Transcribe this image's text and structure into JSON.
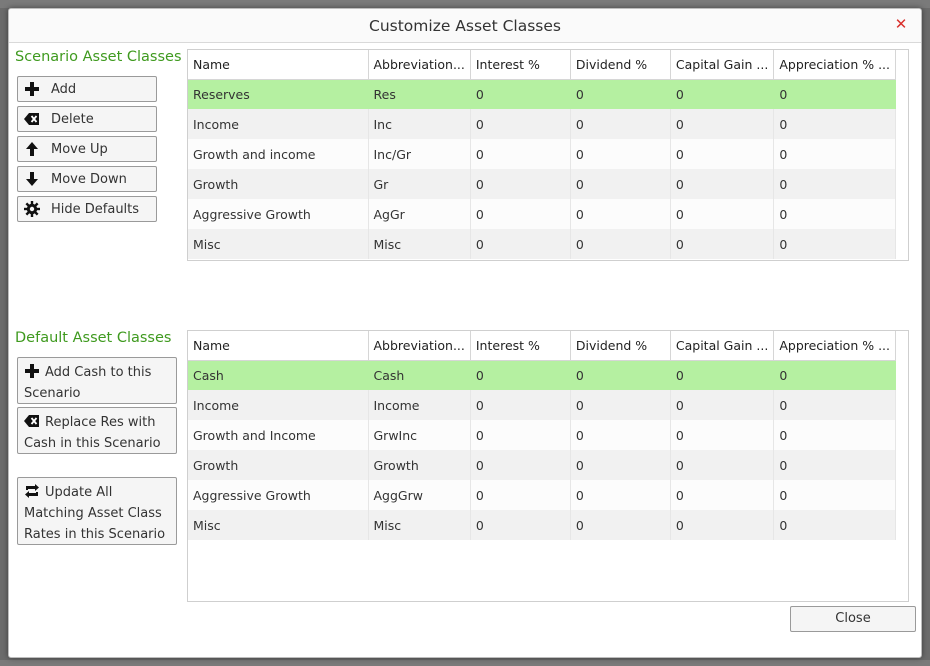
{
  "dialog": {
    "title": "Customize Asset Classes",
    "close_button_label": "Close"
  },
  "scenario": {
    "section_title": "Scenario Asset Classes",
    "buttons": [
      {
        "label": "Add",
        "icon": "plus-icon"
      },
      {
        "label": "Delete",
        "icon": "backspace-icon"
      },
      {
        "label": "Move Up",
        "icon": "arrow-up-icon"
      },
      {
        "label": "Move Down",
        "icon": "arrow-down-icon"
      },
      {
        "label": "Hide Defaults",
        "icon": "gear-icon"
      }
    ],
    "columns": [
      "Name",
      "Abbreviation...",
      "Interest %",
      "Dividend %",
      "Capital Gain ...",
      "Appreciation % ..."
    ],
    "rows": [
      [
        "Reserves",
        "Res",
        "0",
        "0",
        "0",
        "0"
      ],
      [
        "Income",
        "Inc",
        "0",
        "0",
        "0",
        "0"
      ],
      [
        "Growth and income",
        "Inc/Gr",
        "0",
        "0",
        "0",
        "0"
      ],
      [
        "Growth",
        "Gr",
        "0",
        "0",
        "0",
        "0"
      ],
      [
        "Aggressive Growth",
        "AgGr",
        "0",
        "0",
        "0",
        "0"
      ],
      [
        "Misc",
        "Misc",
        "0",
        "0",
        "0",
        "0"
      ]
    ],
    "selected_row": 0
  },
  "defaults": {
    "section_title": "Default Asset Classes",
    "buttons": [
      {
        "line1": "Add Cash to this",
        "line2": "Scenario",
        "icon": "plus-icon"
      },
      {
        "line1": "Replace Res with",
        "line2": "Cash in this Scenario",
        "icon": "backspace-icon"
      },
      {
        "line1": "Update All",
        "line2": "Matching Asset Class",
        "line3": "Rates in this Scenario",
        "icon": "swap-icon"
      }
    ],
    "columns": [
      "Name",
      "Abbreviation...",
      "Interest %",
      "Dividend %",
      "Capital Gain ...",
      "Appreciation % ..."
    ],
    "rows": [
      [
        "Cash",
        "Cash",
        "0",
        "0",
        "0",
        "0"
      ],
      [
        "Income",
        "Income",
        "0",
        "0",
        "0",
        "0"
      ],
      [
        "Growth and Income",
        "GrwInc",
        "0",
        "0",
        "0",
        "0"
      ],
      [
        "Growth",
        "Growth",
        "0",
        "0",
        "0",
        "0"
      ],
      [
        "Aggressive Growth",
        "AggGrw",
        "0",
        "0",
        "0",
        "0"
      ],
      [
        "Misc",
        "Misc",
        "0",
        "0",
        "0",
        "0"
      ]
    ],
    "selected_row": 0
  },
  "colors": {
    "section_title": "#3f9a1f",
    "selected_row": "#b5f0a1",
    "close_x": "#d9302c"
  }
}
